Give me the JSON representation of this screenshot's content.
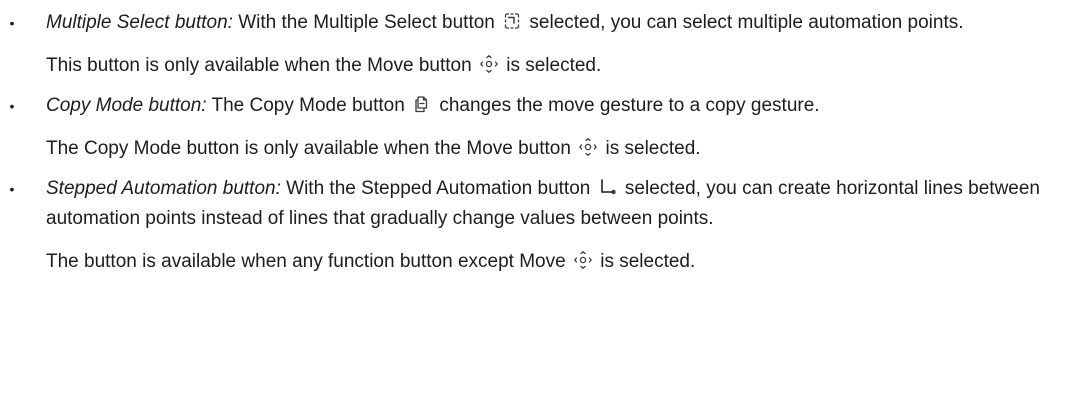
{
  "items": [
    {
      "term": "Multiple Select button:",
      "text_before_icon": " With the Multiple Select button ",
      "icon": "multiple-select-icon",
      "text_after_icon": " selected, you can select multiple automation points.",
      "note_before_icon": "This button is only available when the Move button ",
      "note_icon": "move-icon",
      "note_after_icon": " is selected."
    },
    {
      "term": "Copy Mode button:",
      "text_before_icon": " The Copy Mode button ",
      "icon": "copy-mode-icon",
      "text_after_icon": " changes the move gesture to a copy gesture.",
      "note_before_icon": "The Copy Mode button is only available when the Move button ",
      "note_icon": "move-icon",
      "note_after_icon": " is selected."
    },
    {
      "term": "Stepped Automation button:",
      "text_before_icon": " With the Stepped Automation button ",
      "icon": "stepped-automation-icon",
      "text_after_icon": " selected, you can create horizontal lines between automation points instead of lines that gradually change values between points.",
      "note_before_icon": "The button is available when any function button except Move ",
      "note_icon": "move-icon",
      "note_after_icon": " is selected."
    }
  ],
  "bullet": "•"
}
